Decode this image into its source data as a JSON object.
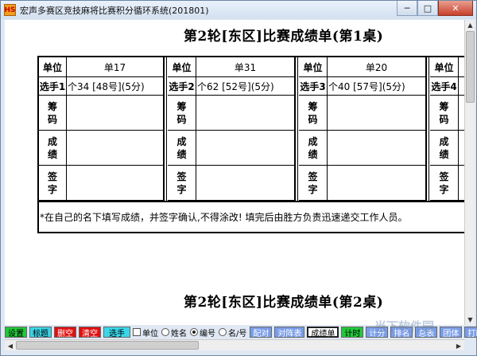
{
  "window": {
    "title": "宏声多赛区竞技麻将比赛积分循环系统(201801)",
    "icon_text": "HS",
    "minimize": "─",
    "maximize": "□",
    "close": "✕"
  },
  "sheet1": {
    "title": "第2轮[东区]比赛成绩单(第1桌)",
    "blocks": [
      {
        "unit_label": "单位",
        "unit_value": "单17",
        "player_label": "选手1",
        "player_value": "个34 [48号](5分)",
        "chips": "筹码",
        "score": "成绩",
        "sign": "签字"
      },
      {
        "unit_label": "单位",
        "unit_value": "单31",
        "player_label": "选手2",
        "player_value": "个62 [52号](5分)",
        "chips": "筹码",
        "score": "成绩",
        "sign": "签字"
      },
      {
        "unit_label": "单位",
        "unit_value": "单20",
        "player_label": "选手3",
        "player_value": "个40 [57号](5分)",
        "chips": "筹码",
        "score": "成绩",
        "sign": "签字"
      },
      {
        "unit_label": "单位",
        "unit_value": "",
        "player_label": "选手4",
        "player_value": "",
        "chips": "筹码",
        "score": "成绩",
        "sign": "签字"
      }
    ],
    "note": "*在自己的名下填写成绩，并签字确认,不得涂改! 填完后由胜方负责迅速递交工作人员。"
  },
  "sheet2": {
    "title": "第2轮[东区]比赛成绩单(第2桌)"
  },
  "toolbar": {
    "settings": "设置",
    "heading": "标题",
    "delete_empty": "删空",
    "clear": "清空",
    "players": "选手",
    "opt_unit": "单位",
    "opt_name": "姓名",
    "opt_number": "编号",
    "opt_name_number": "名/号",
    "pairing": "配对",
    "matchup_table": "对阵表",
    "score_sheet": "成绩单",
    "timer": "计时",
    "scoring": "计分",
    "ranking": "排名",
    "summary": "总表",
    "team": "团体",
    "print": "打印"
  },
  "watermark": "当下软件园",
  "colors": {
    "green": "#22c83a",
    "cyan": "#3ad6e8",
    "red": "#e01010",
    "blue": "#7a9de8"
  }
}
